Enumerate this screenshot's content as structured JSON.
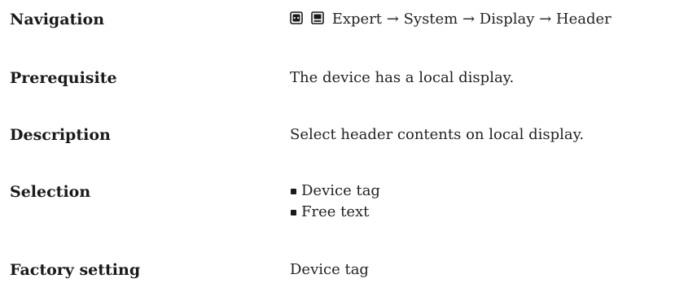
{
  "rows": {
    "navigation": {
      "label": "Navigation",
      "icons": [
        "display-module-icon",
        "local-display-icon"
      ],
      "path": "Expert → System → Display → Header"
    },
    "prerequisite": {
      "label": "Prerequisite",
      "value": "The device has a local display."
    },
    "description": {
      "label": "Description",
      "value": "Select header contents on local display."
    },
    "selection": {
      "label": "Selection",
      "options": [
        "Device tag",
        "Free text"
      ]
    },
    "factory_setting": {
      "label": "Factory setting",
      "value": "Device tag"
    }
  }
}
